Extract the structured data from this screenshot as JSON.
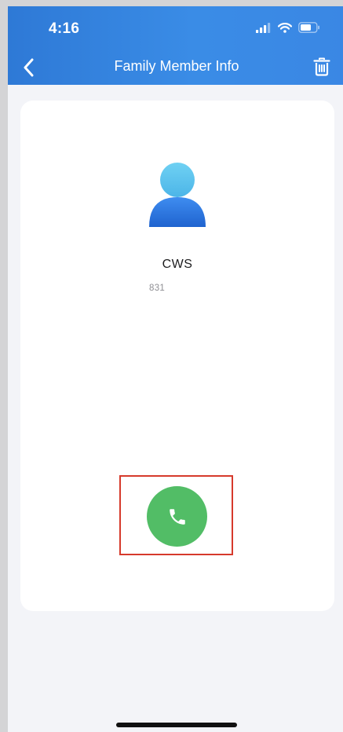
{
  "status_bar": {
    "time": "4:16",
    "icons": [
      "cellular-signal-icon",
      "wifi-icon",
      "battery-icon"
    ]
  },
  "nav": {
    "title": "Family Member Info",
    "back_icon": "chevron-left-icon",
    "delete_icon": "trash-icon"
  },
  "contact": {
    "name": "CWS",
    "number": "831",
    "avatar_icon": "person-icon"
  },
  "actions": {
    "call_icon": "phone-icon"
  },
  "colors": {
    "header": "#3a87e4",
    "call_button": "#52bd66",
    "highlight": "#d63a2c",
    "background": "#f3f4f8",
    "card": "#ffffff"
  }
}
